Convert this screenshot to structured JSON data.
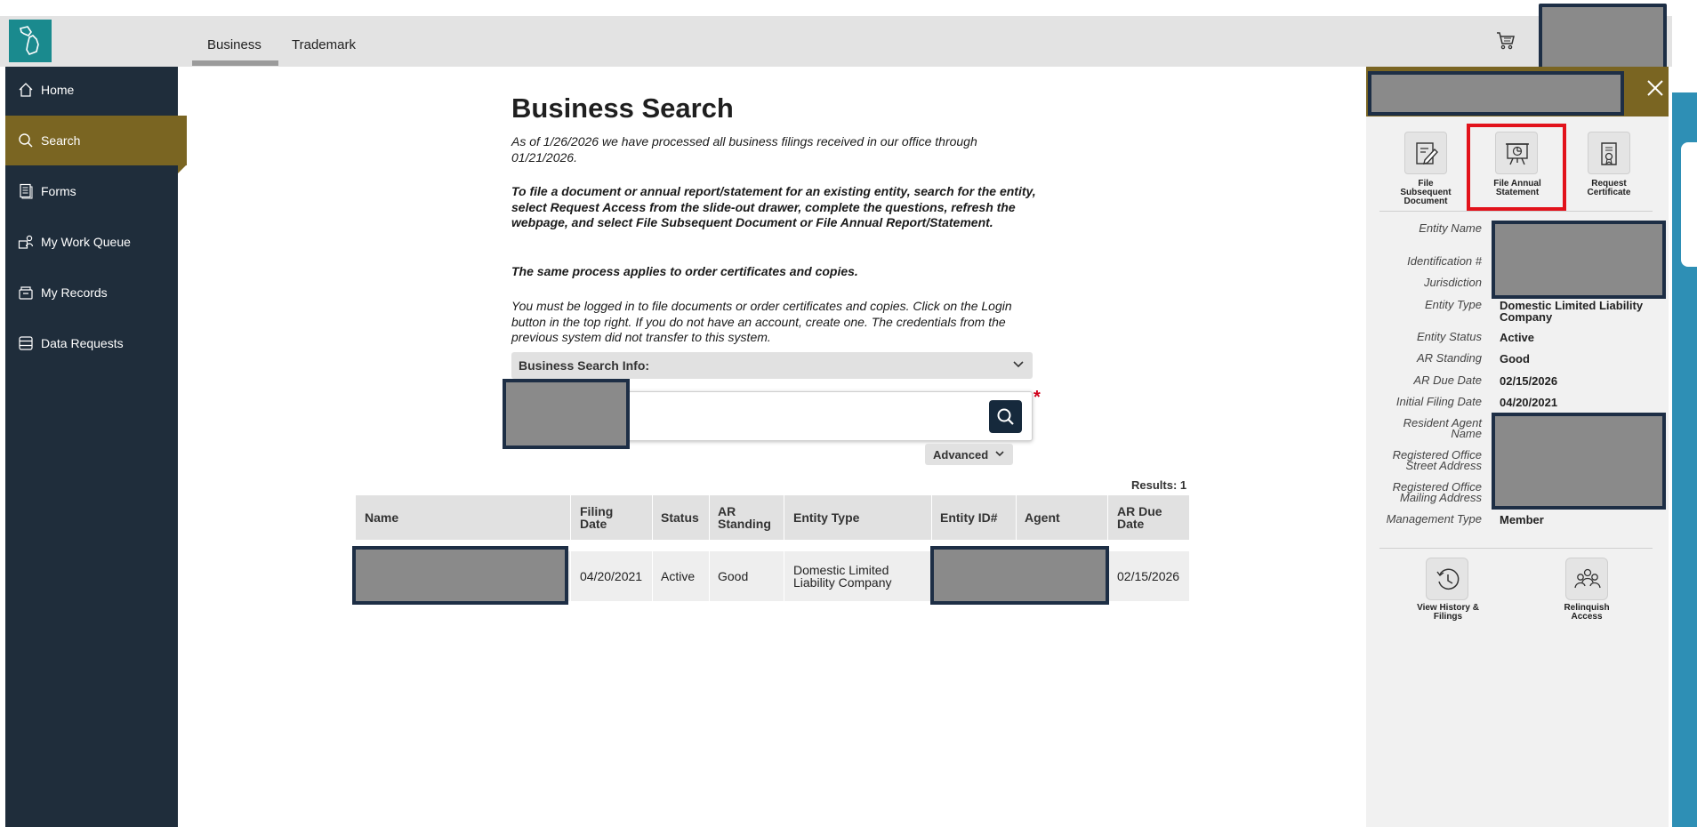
{
  "topbar": {
    "tabs": [
      {
        "label": "Business",
        "active": true
      },
      {
        "label": "Trademark",
        "active": false
      }
    ]
  },
  "sidebar": {
    "items": [
      {
        "label": "Home",
        "icon": "home-icon"
      },
      {
        "label": "Search",
        "icon": "search-icon",
        "active": true
      },
      {
        "label": "Forms",
        "icon": "forms-icon"
      },
      {
        "label": "My Work Queue",
        "icon": "work-queue-icon"
      },
      {
        "label": "My Records",
        "icon": "records-icon"
      },
      {
        "label": "Data Requests",
        "icon": "database-icon"
      }
    ]
  },
  "main": {
    "title": "Business Search",
    "paragraphs": [
      "As of 1/26/2026 we have processed all business filings received in our office through 01/21/2026.",
      "To file a document or annual report/statement for an existing entity, search for the entity, select Request Access from the slide-out drawer, complete the questions, refresh the webpage, and select File Subsequent Document or File Annual Report/Statement.",
      "The same process applies to order certificates and copies.",
      "You must be logged in to file documents or order certificates and copies. Click on the Login button in the top right. If you do not have an account, create one. The credentials from the previous system did not transfer to this system."
    ],
    "info_label": "Business Search Info:",
    "required_marker": "*",
    "advanced_label": "Advanced",
    "results_label": "Results: 1"
  },
  "table": {
    "columns": [
      "Name",
      "Filing Date",
      "Status",
      "AR Standing",
      "Entity Type",
      "Entity ID#",
      "Agent",
      "AR Due Date"
    ],
    "rows": [
      {
        "name": "",
        "filing_date": "04/20/2021",
        "status": "Active",
        "ar_standing": "Good",
        "entity_type": "Domestic Limited Liability Company",
        "entity_id": "",
        "agent": "",
        "ar_due_date": "02/15/2026"
      }
    ]
  },
  "panel": {
    "actions": [
      {
        "label": "File Subsequent Document",
        "icon": "file-edit-icon"
      },
      {
        "label": "File Annual Statement",
        "icon": "presentation-icon"
      },
      {
        "label": "Request Certificate",
        "icon": "certificate-icon"
      }
    ],
    "details": [
      {
        "label": "Entity Name",
        "value": ""
      },
      {
        "label": "Identification #",
        "value": ""
      },
      {
        "label": "Jurisdiction",
        "value": ""
      },
      {
        "label": "Entity Type",
        "value": "Domestic Limited Liability Company"
      },
      {
        "label": "Entity Status",
        "value": "Active"
      },
      {
        "label": "AR Standing",
        "value": "Good"
      },
      {
        "label": "AR Due Date",
        "value": "02/15/2026"
      },
      {
        "label": "Initial Filing Date",
        "value": "04/20/2021"
      },
      {
        "label": "Resident Agent Name",
        "value": ""
      },
      {
        "label": "Registered Office Street Address",
        "value": ""
      },
      {
        "label": "Registered Office Mailing Address",
        "value": ""
      },
      {
        "label": "Management Type",
        "value": "Member"
      }
    ],
    "bottom_actions": [
      {
        "label": "View History & Filings",
        "icon": "history-icon"
      },
      {
        "label": "Relinquish Access",
        "icon": "users-icon"
      }
    ]
  },
  "colors": {
    "sidebar": "#1f2d3b",
    "accent_gold": "#7a6522",
    "logo_teal": "#1a8a8e",
    "search_button": "#16293c",
    "highlight_red": "#e2121b"
  }
}
